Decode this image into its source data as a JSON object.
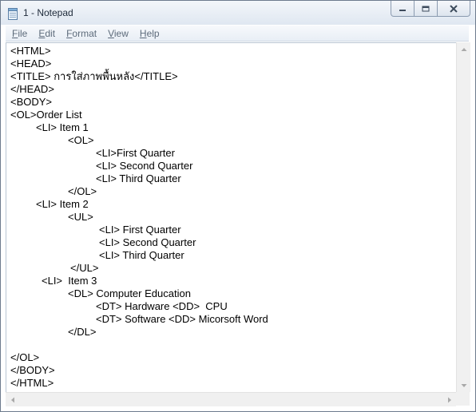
{
  "window": {
    "title": "1 - Notepad",
    "controls": {
      "minimize": "minimize-icon",
      "maximize": "maximize-icon",
      "close": "close-icon"
    }
  },
  "menu": [
    "File",
    "Edit",
    "Format",
    "View",
    "Help"
  ],
  "editor": {
    "lines": [
      "<HTML>",
      "<HEAD>",
      "<TITLE> การใส่ภาพพื้นหลัง</TITLE>",
      "</HEAD>",
      "<BODY>",
      "<OL>Order List",
      "<LI> Item 1",
      "<OL>",
      "<LI>First Quarter",
      "<LI> Second Quarter",
      "<LI> Third Quarter",
      "</OL>",
      "<LI> Item 2",
      "<UL>",
      "<LI> First Quarter",
      "<LI> Second Quarter",
      "<LI> Third Quarter",
      "</UL>",
      "<LI>  Item 3",
      "<DL> Computer Education",
      "<DT> Hardware <DD>  CPU",
      "<DT> Software <DD> Micorsoft Word",
      "</DL>",
      "",
      "</OL>",
      "</BODY>",
      "</HTML>"
    ]
  }
}
